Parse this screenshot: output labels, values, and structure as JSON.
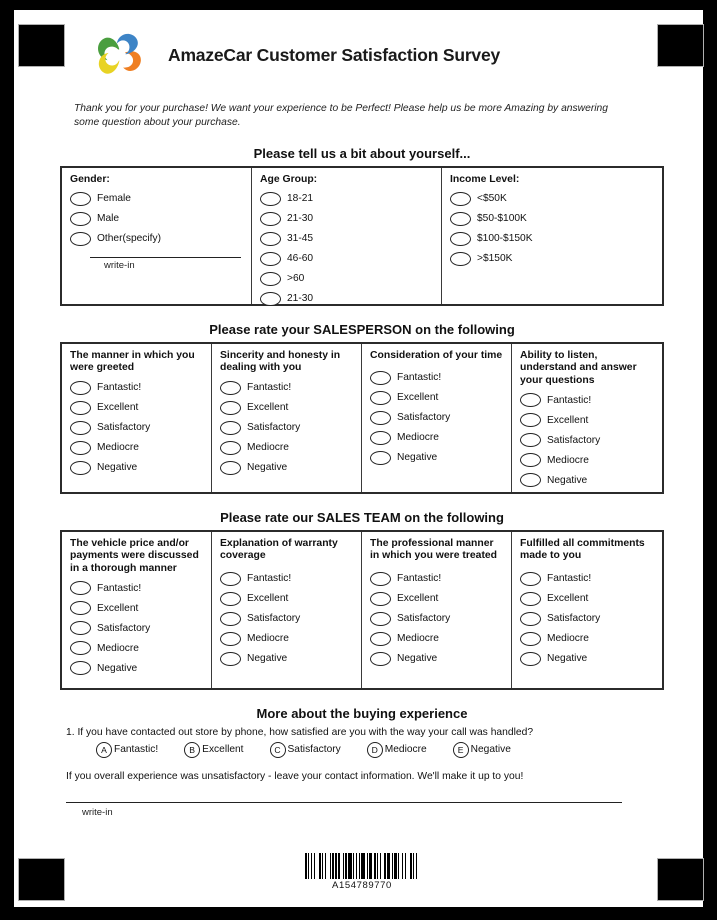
{
  "document": {
    "title": "AmazeCar Customer Satisfaction Survey",
    "intro": "Thank you for your purchase! We want your experience to be Perfect! Please help us be more Amazing by answering some question about your purchase.",
    "logo_icon": "swirl-pinwheel-logo"
  },
  "about_you": {
    "heading": "Please tell us a bit about yourself...",
    "columns": [
      {
        "title": "Gender:",
        "options": [
          "Female",
          "Male",
          "Other(specify)"
        ],
        "writein_label": "write-in"
      },
      {
        "title": "Age Group:",
        "options": [
          "18-21",
          "21-30",
          "31-45",
          "46-60",
          ">60",
          "21-30"
        ]
      },
      {
        "title": "Income Level:",
        "options": [
          "<$50K",
          "$50-$100K",
          "$100-$150K",
          ">$150K"
        ]
      }
    ]
  },
  "salesperson": {
    "heading": "Please rate your SALESPERSON on the following",
    "columns": [
      {
        "title": "The manner in which you were greeted",
        "options": [
          "Fantastic!",
          "Excellent",
          "Satisfactory",
          "Mediocre",
          "Negative"
        ]
      },
      {
        "title": "Sincerity and honesty in dealing with you",
        "options": [
          "Fantastic!",
          "Excellent",
          "Satisfactory",
          "Mediocre",
          "Negative"
        ]
      },
      {
        "title": "Consideration of your time",
        "options": [
          "Fantastic!",
          "Excellent",
          "Satisfactory",
          "Mediocre",
          "Negative"
        ]
      },
      {
        "title": "Ability to listen, understand and answer your questions",
        "options": [
          "Fantastic!",
          "Excellent",
          "Satisfactory",
          "Mediocre",
          "Negative"
        ]
      }
    ]
  },
  "sales_team": {
    "heading": "Please rate our SALES TEAM on the following",
    "columns": [
      {
        "title": "The vehicle price and/or payments were discussed in a thorough manner",
        "options": [
          "Fantastic!",
          "Excellent",
          "Satisfactory",
          "Mediocre",
          "Negative"
        ]
      },
      {
        "title": "Explanation of warranty coverage",
        "options": [
          "Fantastic!",
          "Excellent",
          "Satisfactory",
          "Mediocre",
          "Negative"
        ]
      },
      {
        "title": "The professional manner in which you were treated",
        "options": [
          "Fantastic!",
          "Excellent",
          "Satisfactory",
          "Mediocre",
          "Negative"
        ]
      },
      {
        "title": "Fulfilled all commitments made to you",
        "options": [
          "Fantastic!",
          "Excellent",
          "Satisfactory",
          "Mediocre",
          "Negative"
        ]
      }
    ]
  },
  "buying_experience": {
    "heading": "More about the buying experience",
    "question": "1. If you have contacted out store by phone, how satisfied are you with the way your call was handled?",
    "lettered_options": [
      {
        "letter": "A",
        "label": "Fantastic!"
      },
      {
        "letter": "B",
        "label": "Excellent"
      },
      {
        "letter": "C",
        "label": "Satisfactory"
      },
      {
        "letter": "D",
        "label": "Mediocre"
      },
      {
        "letter": "E",
        "label": "Negative"
      }
    ],
    "note": "If you overall experience was unsatisfactory - leave your contact information. We'll make it up to you!",
    "writein_label": "write-in"
  },
  "barcode": {
    "number": "A154789770",
    "pattern": "211212132112131121211311213112121132113121121311321121131213211212"
  },
  "colors": {
    "ink": "#111111",
    "rule": "#2b2b2b",
    "logo_green": "#4a9e3f",
    "logo_blue": "#3d84c6",
    "logo_orange": "#ef7f22",
    "logo_yellow": "#e8d324"
  }
}
